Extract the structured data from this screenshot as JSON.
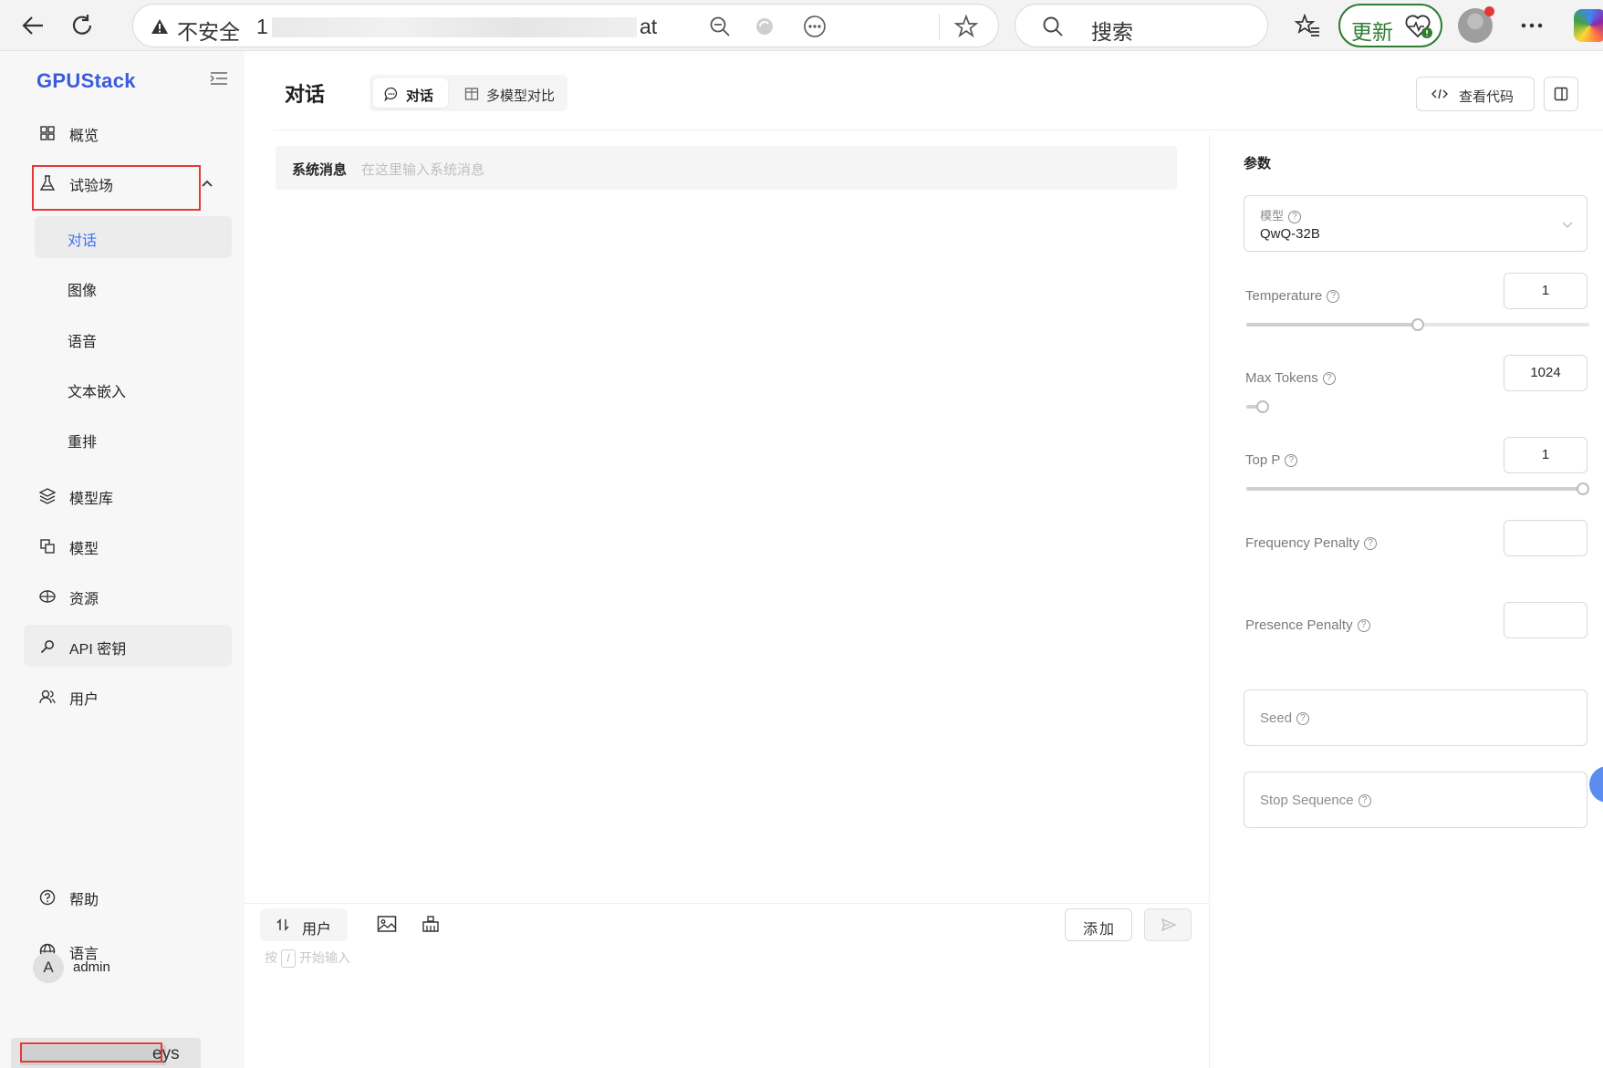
{
  "browser": {
    "insecure_label": "不安全",
    "url_prefix": "1",
    "url_suffix": "at",
    "search_label": "搜索",
    "update_label": "更新"
  },
  "sidebar": {
    "logo": "GPUStack",
    "items": [
      {
        "label": "概览",
        "icon": "dashboard-icon"
      },
      {
        "label": "试验场",
        "icon": "flask-icon"
      },
      {
        "label": "模型库",
        "icon": "model-library-icon"
      },
      {
        "label": "模型",
        "icon": "model-icon"
      },
      {
        "label": "资源",
        "icon": "resource-icon"
      },
      {
        "label": "API 密钥",
        "icon": "key-icon"
      },
      {
        "label": "用户",
        "icon": "users-icon"
      }
    ],
    "sub_items": [
      "对话",
      "图像",
      "语音",
      "文本嵌入",
      "重排"
    ],
    "help_label": "帮助",
    "language_label": "语言",
    "user_initial": "A",
    "user_name": "admin",
    "popup_fragment": "eys"
  },
  "header": {
    "title": "对话",
    "tabs": [
      "对话",
      "多模型对比"
    ],
    "view_code_label": "查看代码"
  },
  "chat": {
    "system_label": "系统消息",
    "system_placeholder": "在这里输入系统消息",
    "role_label": "用户",
    "hint_prefix": "按",
    "hint_key": "/",
    "hint_suffix": "开始输入",
    "add_label": "添加"
  },
  "params": {
    "title": "参数",
    "model_label": "模型",
    "model_value": "QwQ-32B",
    "temperature": {
      "label": "Temperature",
      "value": "1",
      "slider_fraction": 0.5
    },
    "max_tokens": {
      "label": "Max Tokens",
      "value": "1024",
      "slider_fraction": 0.03
    },
    "top_p": {
      "label": "Top P",
      "value": "1",
      "slider_fraction": 1.0
    },
    "frequency_penalty": {
      "label": "Frequency Penalty",
      "value": ""
    },
    "presence_penalty": {
      "label": "Presence Penalty",
      "value": ""
    },
    "seed_label": "Seed",
    "stop_sequence_label": "Stop Sequence"
  },
  "colors": {
    "accent": "#3b6ff5",
    "highlight_box": "#e53935",
    "update_green": "#2e7d32"
  }
}
